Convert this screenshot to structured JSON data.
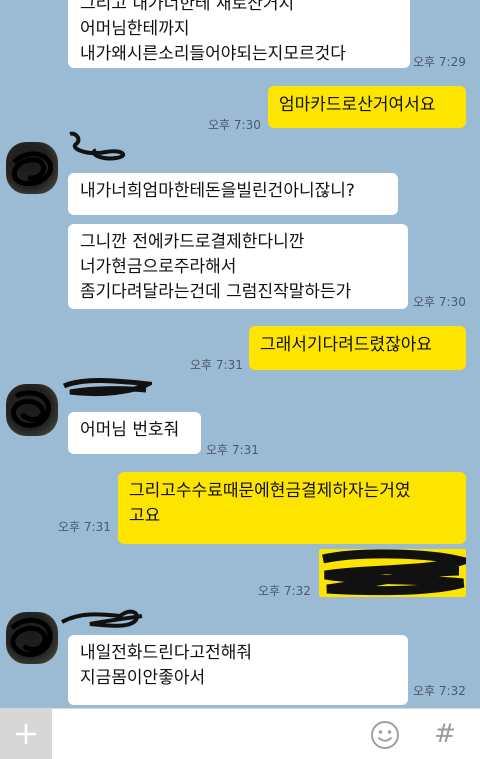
{
  "messages": {
    "m1": {
      "lines": [
        "그리고 내가너한테 새로산거지",
        "어머님한테까지",
        "내가왜시른소리들어야되는지모르것다"
      ],
      "time": "오후 7:29"
    },
    "m2": {
      "text": "엄마카드로산거여서요",
      "time": "오후 7:30"
    },
    "m3": {
      "text": "내가너희엄마한테돈을빌린건아니잖니?"
    },
    "m4": {
      "lines": [
        "그니깐 전에카드로결제한다니깐",
        "너가현금으로주라해서",
        "좀기다려달라는건데 그럼진작말하든가"
      ],
      "time": "오후 7:30"
    },
    "m5": {
      "text": "그래서기다려드렸잖아요",
      "time": "오후 7:31"
    },
    "m6": {
      "text": "어머님 번호줘",
      "time": "오후 7:31"
    },
    "m7": {
      "lines": [
        "그리고수수료때문에현금결제하자는거였",
        "고요"
      ],
      "time": "오후 7:31"
    },
    "m8": {
      "text": "",
      "time": "오후 7:32"
    },
    "m9": {
      "lines": [
        "내일전화드린다고전해줘",
        "지금몸이안좋아서"
      ],
      "time": "오후 7:32"
    }
  },
  "input": {
    "placeholder": "",
    "value": ""
  },
  "icons": {
    "attach": "plus-icon",
    "emoji": "emoji-icon",
    "hashtag": "hash-icon"
  },
  "colors": {
    "background": "#9bbbd4",
    "outgoing": "#fee500",
    "incoming": "#ffffff"
  }
}
